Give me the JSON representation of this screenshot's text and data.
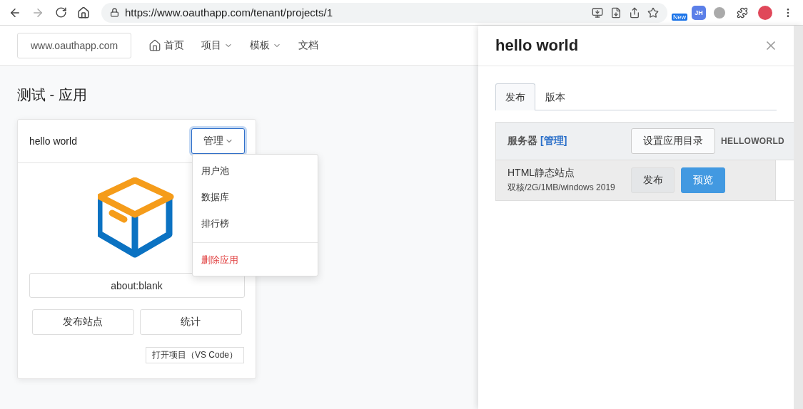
{
  "browser": {
    "url": "https://www.oauthapp.com/tenant/projects/1",
    "extension_badge": "New",
    "profile_initials": "JH"
  },
  "navbar": {
    "brand": "www.oauthapp.com",
    "items": [
      {
        "label": "首页",
        "kind": "home"
      },
      {
        "label": "项目",
        "kind": "dropdown"
      },
      {
        "label": "模板",
        "kind": "dropdown"
      },
      {
        "label": "文档",
        "kind": "plain"
      }
    ]
  },
  "page_title": "测试 - 应用",
  "app_card": {
    "name": "hello world",
    "manage_button": "管理",
    "menu": [
      {
        "label": "用户池",
        "kind": "item"
      },
      {
        "label": "数据库",
        "kind": "item"
      },
      {
        "label": "排行榜",
        "kind": "item"
      },
      {
        "label": "删除应用",
        "kind": "danger"
      }
    ],
    "address": "about:blank",
    "buttons": [
      "发布站点",
      "统计"
    ],
    "open_button": "打开项目（VS Code）"
  },
  "drawer": {
    "title": "hello world",
    "tabs": [
      {
        "label": "发布",
        "selected": true
      },
      {
        "label": "版本",
        "selected": false
      }
    ],
    "server": {
      "label": "服务器",
      "link": "[管理]",
      "set_dir_button": "设置应用目录",
      "name": "HELLOWORLD"
    },
    "rows": [
      {
        "name": "HTML静态站点",
        "spec": "双核/2G/1MB/windows 2019",
        "publish_button": "发布",
        "preview_button": "预览"
      }
    ]
  }
}
